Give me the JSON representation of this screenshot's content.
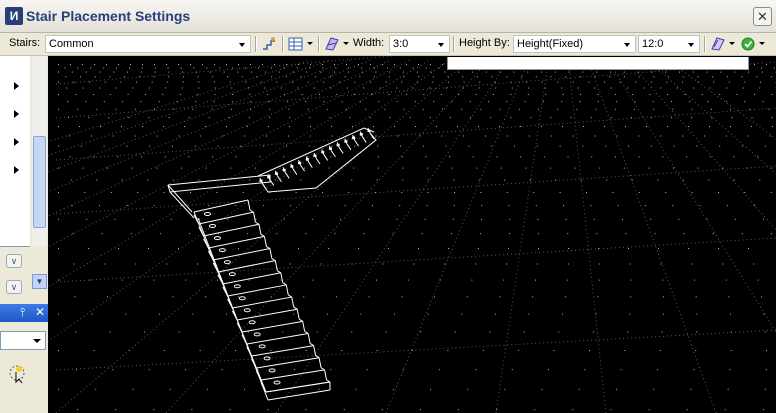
{
  "dialog": {
    "title": "Stair Placement Settings",
    "app_icon_letter": "И",
    "close_glyph": "✕"
  },
  "toolbar": {
    "stairs_label": "Stairs:",
    "stairs_value": "Common",
    "width_label": "Width:",
    "width_value": "3:0",
    "height_by_label": "Height By:",
    "height_by_value": "Height(Fixed)",
    "height_value": "12:0"
  },
  "icons": {
    "stairs_tool": "stair-settings-icon",
    "layout_tool": "layout-icon",
    "pattern_tool": "pattern-icon",
    "display_tool": "display-icon",
    "ok_tool": "green-check-icon"
  },
  "left_panel": {
    "scroll_down_glyph": "▼",
    "chevron_glyph": "∨",
    "pin_glyph": "⫯",
    "close_glyph": "✕"
  },
  "colors": {
    "viewport_bg": "#000000",
    "grid_dot": "#b4b4b4",
    "wireframe": "#ffffff",
    "title_text": "#27407a",
    "panel_header": "#2563d6"
  }
}
